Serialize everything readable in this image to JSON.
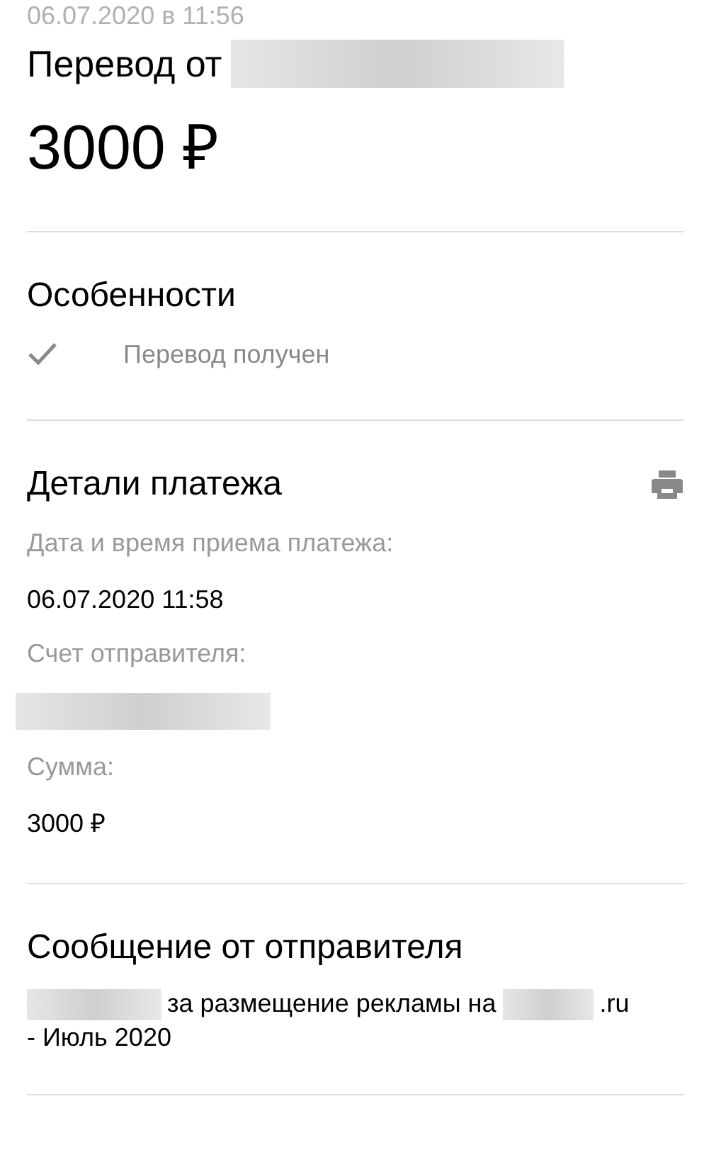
{
  "date": "06.07.2020 в 11:56",
  "title": {
    "text": "Перевод от",
    "redacted": true
  },
  "amount": "3000 ₽",
  "features": {
    "heading": "Особенности",
    "items": [
      {
        "label": "Перевод получен",
        "checked": true
      }
    ]
  },
  "details": {
    "heading": "Детали платежа",
    "fields": [
      {
        "label": "Дата и время приема платежа:",
        "value": {
          "kind": "text",
          "text": "06.07.2020 11:58"
        }
      },
      {
        "label": "Счет отправителя:",
        "value": {
          "kind": "redacted"
        }
      },
      {
        "label": "Сумма:",
        "value": {
          "kind": "text",
          "text": "3000 ₽"
        }
      }
    ]
  },
  "message": {
    "heading": "Сообщение от отправителя",
    "parts": [
      {
        "kind": "redacted"
      },
      {
        "kind": "text",
        "text": "за размещение рекламы на"
      },
      {
        "kind": "redacted"
      },
      {
        "kind": "text",
        "text": ".ru"
      },
      {
        "kind": "text",
        "text": "- Июль 2020"
      }
    ]
  }
}
